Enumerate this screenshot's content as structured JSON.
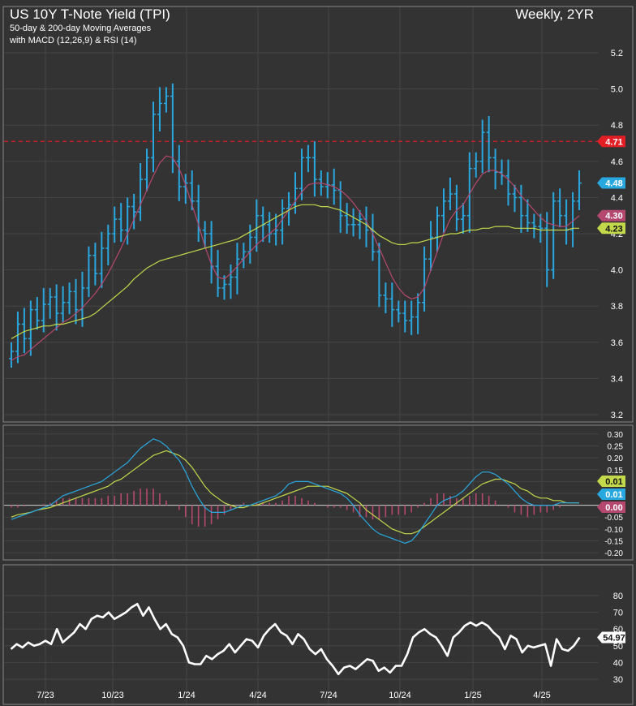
{
  "header": {
    "title": "US 10Y T-Note Yield (TPI)",
    "subtitle_1": "50-day & 200-day Moving Averages",
    "subtitle_2": "with MACD (12,26,9) & RSI (14)",
    "timeframe": "Weekly, 2YR"
  },
  "colors": {
    "background": "#333333",
    "price": "#29a8e0",
    "ma_fast": "#b5486e",
    "ma_slow": "#c3d84a",
    "resistance": "#e31e24",
    "macd": "#29a8e0",
    "signal": "#c3d84a",
    "hist": "#b5486e",
    "rsi": "#ffffff"
  },
  "x_axis": {
    "ticks": [
      "7/23",
      "10/23",
      "1/24",
      "4/24",
      "7/24",
      "10/24",
      "1/25",
      "4/25"
    ]
  },
  "chart_data": [
    {
      "type": "bar",
      "panel": "price",
      "ylim": [
        3.2,
        5.2
      ],
      "yticks": [
        "5.2",
        "5.0",
        "4.8",
        "4.6",
        "4.4",
        "4.2",
        "4.0",
        "3.8",
        "3.6",
        "3.4",
        "3.2"
      ],
      "reference_line": {
        "value": 4.71,
        "label": "4.71"
      },
      "markers": [
        {
          "label": "4.71",
          "value": 4.71,
          "color": "#e31e24"
        },
        {
          "label": "4.48",
          "value": 4.48,
          "color": "#29a8e0"
        },
        {
          "label": "4.30",
          "value": 4.3,
          "color": "#b5486e"
        },
        {
          "label": "4.23",
          "value": 4.23,
          "color": "#c3d84a"
        }
      ],
      "series": [
        {
          "values": [
            3.55,
            3.7,
            3.62,
            3.78,
            3.72,
            3.81,
            3.85,
            3.76,
            3.82,
            3.88,
            3.78,
            3.9,
            4.08,
            3.98,
            4.12,
            4.2,
            4.28,
            4.22,
            4.35,
            4.32,
            4.5,
            4.62,
            4.86,
            4.92,
            4.96,
            4.6,
            4.46,
            4.48,
            4.38,
            4.22,
            4.2,
            4.02,
            3.9,
            3.92,
            3.96,
            4.06,
            4.1,
            4.18,
            4.3,
            4.25,
            4.2,
            4.22,
            4.34,
            4.36,
            4.45,
            4.62,
            4.62,
            4.5,
            4.46,
            4.47,
            4.44,
            4.3,
            4.25,
            4.25,
            4.28,
            4.22,
            4.1,
            3.86,
            3.84,
            3.78,
            3.76,
            3.72,
            3.74,
            3.82,
            4.06,
            4.18,
            4.3,
            4.38,
            4.42,
            4.28,
            4.3,
            4.56,
            4.6,
            4.76,
            4.62,
            4.54,
            4.52,
            4.42,
            4.4,
            4.3,
            4.26,
            4.24,
            4.23,
            4.0,
            4.38,
            4.3,
            4.22,
            4.38,
            4.48
          ]
        },
        {
          "name": "",
          "values": [
            3.5,
            3.52,
            3.53,
            3.56,
            3.59,
            3.62,
            3.65,
            3.68,
            3.71,
            3.73,
            3.76,
            3.79,
            3.83,
            3.87,
            3.92,
            3.98,
            4.05,
            4.12,
            4.2,
            4.28,
            4.36,
            4.44,
            4.52,
            4.59,
            4.63,
            4.62,
            4.56,
            4.47,
            4.36,
            4.25,
            4.13,
            4.03,
            3.96,
            3.95,
            3.98,
            4.02,
            4.06,
            4.1,
            4.14,
            4.17,
            4.2,
            4.23,
            4.28,
            4.33,
            4.38,
            4.43,
            4.47,
            4.48,
            4.48,
            4.47,
            4.46,
            4.44,
            4.41,
            4.37,
            4.32,
            4.27,
            4.2,
            4.12,
            4.04,
            3.96,
            3.9,
            3.86,
            3.84,
            3.85,
            3.9,
            4.0,
            4.1,
            4.2,
            4.28,
            4.33,
            4.36,
            4.42,
            4.48,
            4.53,
            4.55,
            4.55,
            4.53,
            4.5,
            4.46,
            4.41,
            4.37,
            4.33,
            4.29,
            4.26,
            4.25,
            4.24,
            4.24,
            4.27,
            4.3
          ]
        },
        {
          "name": "",
          "values": [
            3.62,
            3.64,
            3.66,
            3.67,
            3.68,
            3.69,
            3.69,
            3.7,
            3.7,
            3.71,
            3.72,
            3.73,
            3.74,
            3.76,
            3.79,
            3.82,
            3.85,
            3.88,
            3.91,
            3.95,
            3.98,
            4.01,
            4.03,
            4.05,
            4.06,
            4.07,
            4.08,
            4.09,
            4.1,
            4.11,
            4.12,
            4.13,
            4.14,
            4.15,
            4.16,
            4.17,
            4.19,
            4.21,
            4.23,
            4.25,
            4.27,
            4.29,
            4.31,
            4.33,
            4.35,
            4.36,
            4.36,
            4.36,
            4.35,
            4.35,
            4.34,
            4.33,
            4.31,
            4.29,
            4.27,
            4.25,
            4.22,
            4.19,
            4.17,
            4.15,
            4.14,
            4.14,
            4.15,
            4.15,
            4.16,
            4.17,
            4.18,
            4.19,
            4.2,
            4.2,
            4.21,
            4.22,
            4.22,
            4.23,
            4.23,
            4.24,
            4.24,
            4.24,
            4.23,
            4.23,
            4.23,
            4.23,
            4.22,
            4.22,
            4.22,
            4.22,
            4.22,
            4.23,
            4.23
          ]
        }
      ]
    },
    {
      "type": "line",
      "panel": "macd",
      "ylim": [
        -0.21,
        0.31
      ],
      "yticks": [
        "0.30",
        "0.25",
        "0.20",
        "0.15",
        "0.10",
        "0.05",
        "0.00",
        "-0.05",
        "-0.10",
        "-0.15",
        "-0.20"
      ],
      "markers": [
        {
          "label": "0.01",
          "value": 0.01,
          "color": "#c3d84a"
        },
        {
          "label": "0.01",
          "value": 0.01,
          "color": "#29a8e0"
        },
        {
          "label": "0.00",
          "value": 0.0,
          "color": "#b5486e"
        }
      ],
      "series": [
        {
          "values": [
            -0.06,
            -0.05,
            -0.04,
            -0.03,
            -0.02,
            -0.01,
            0.0,
            0.02,
            0.04,
            0.05,
            0.06,
            0.07,
            0.08,
            0.09,
            0.1,
            0.12,
            0.14,
            0.16,
            0.18,
            0.21,
            0.24,
            0.26,
            0.28,
            0.27,
            0.25,
            0.22,
            0.19,
            0.14,
            0.08,
            0.03,
            -0.01,
            -0.03,
            -0.03,
            -0.03,
            -0.02,
            -0.01,
            0.0,
            0.0,
            0.01,
            0.02,
            0.03,
            0.04,
            0.06,
            0.09,
            0.1,
            0.1,
            0.1,
            0.09,
            0.08,
            0.07,
            0.06,
            0.05,
            0.03,
            0.0,
            -0.04,
            -0.07,
            -0.1,
            -0.12,
            -0.13,
            -0.14,
            -0.15,
            -0.16,
            -0.15,
            -0.12,
            -0.08,
            -0.04,
            0.0,
            0.02,
            0.03,
            0.04,
            0.06,
            0.09,
            0.12,
            0.14,
            0.14,
            0.13,
            0.11,
            0.09,
            0.06,
            0.03,
            0.01,
            0.0,
            0.0,
            0.0,
            0.0,
            0.01,
            0.01,
            0.01,
            0.01
          ]
        },
        {
          "values": [
            -0.05,
            -0.04,
            -0.035,
            -0.03,
            -0.02,
            -0.015,
            -0.01,
            0.0,
            0.01,
            0.02,
            0.03,
            0.04,
            0.05,
            0.06,
            0.07,
            0.08,
            0.1,
            0.11,
            0.13,
            0.15,
            0.17,
            0.19,
            0.21,
            0.22,
            0.23,
            0.22,
            0.21,
            0.19,
            0.16,
            0.12,
            0.08,
            0.05,
            0.03,
            0.01,
            0.0,
            -0.01,
            -0.01,
            0.0,
            0.0,
            0.01,
            0.02,
            0.03,
            0.04,
            0.05,
            0.06,
            0.07,
            0.08,
            0.08,
            0.08,
            0.08,
            0.07,
            0.06,
            0.05,
            0.03,
            0.01,
            -0.02,
            -0.04,
            -0.06,
            -0.08,
            -0.1,
            -0.11,
            -0.12,
            -0.12,
            -0.11,
            -0.09,
            -0.07,
            -0.05,
            -0.03,
            -0.01,
            0.01,
            0.03,
            0.05,
            0.07,
            0.09,
            0.1,
            0.11,
            0.11,
            0.1,
            0.09,
            0.07,
            0.06,
            0.04,
            0.03,
            0.03,
            0.02,
            0.02,
            0.01,
            0.01,
            0.01
          ]
        },
        {
          "values": [
            -0.01,
            -0.01,
            -0.005,
            0.0,
            0.0,
            0.005,
            0.01,
            0.02,
            0.03,
            0.03,
            0.03,
            0.03,
            0.03,
            0.03,
            0.03,
            0.04,
            0.04,
            0.05,
            0.05,
            0.06,
            0.07,
            0.07,
            0.07,
            0.05,
            0.02,
            0.0,
            -0.02,
            -0.05,
            -0.08,
            -0.09,
            -0.09,
            -0.08,
            -0.06,
            -0.04,
            -0.02,
            0.0,
            0.01,
            0.0,
            0.01,
            0.01,
            0.01,
            0.01,
            0.02,
            0.04,
            0.04,
            0.03,
            0.02,
            0.01,
            0.0,
            -0.01,
            -0.01,
            -0.01,
            -0.02,
            -0.03,
            -0.05,
            -0.05,
            -0.06,
            -0.06,
            -0.05,
            -0.04,
            -0.04,
            -0.04,
            -0.03,
            -0.01,
            0.01,
            0.03,
            0.05,
            0.05,
            0.04,
            0.03,
            0.03,
            0.04,
            0.05,
            0.05,
            0.04,
            0.02,
            0.0,
            -0.01,
            -0.03,
            -0.04,
            -0.05,
            -0.04,
            -0.03,
            -0.03,
            -0.02,
            -0.01,
            0.0,
            0.0,
            0.0
          ]
        }
      ]
    },
    {
      "type": "line",
      "panel": "rsi",
      "ylim": [
        30,
        80
      ],
      "yticks": [
        "80",
        "70",
        "60",
        "50",
        "40",
        "30"
      ],
      "markers": [
        {
          "label": "54.97",
          "value": 54.97,
          "color": "#ffffff"
        }
      ],
      "series": [
        {
          "values": [
            48,
            51,
            49,
            52,
            50,
            51,
            53,
            51,
            60,
            52,
            55,
            58,
            63,
            60,
            66,
            68,
            67,
            70,
            66,
            68,
            70,
            73,
            75,
            68,
            73,
            66,
            60,
            63,
            57,
            55,
            50,
            40,
            39,
            39,
            44,
            42,
            45,
            47,
            51,
            46,
            50,
            54,
            53,
            49,
            56,
            60,
            63,
            58,
            56,
            51,
            57,
            54,
            48,
            45,
            48,
            42,
            38,
            33,
            37,
            38,
            36,
            39,
            42,
            41,
            35,
            37,
            34,
            38,
            38,
            45,
            55,
            58,
            60,
            57,
            55,
            50,
            44,
            55,
            58,
            62,
            64,
            62,
            64,
            62,
            58,
            55,
            48,
            56,
            54,
            46,
            50,
            49,
            50,
            51,
            38,
            54,
            48,
            47,
            50,
            55
          ]
        }
      ]
    }
  ]
}
